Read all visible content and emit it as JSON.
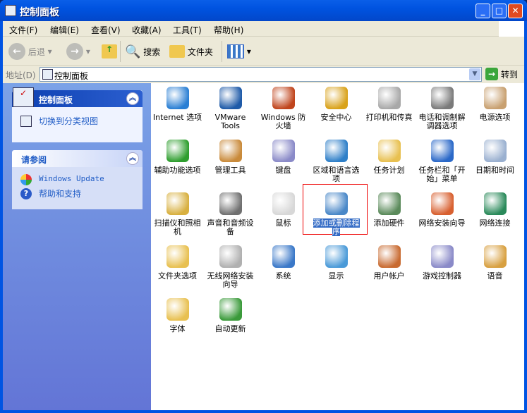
{
  "window": {
    "title": "控制面板"
  },
  "menu": [
    "文件(F)",
    "编辑(E)",
    "查看(V)",
    "收藏(A)",
    "工具(T)",
    "帮助(H)"
  ],
  "toolbar": {
    "back": "后退",
    "search": "搜索",
    "folders": "文件夹"
  },
  "address": {
    "label": "地址(D)",
    "value": "控制面板",
    "go": "转到"
  },
  "sidebar": {
    "panel1": {
      "title": "控制面板",
      "link": "切换到分类视图"
    },
    "panel2": {
      "title": "请参阅",
      "links": [
        "Windows Update",
        "帮助和支持"
      ]
    }
  },
  "items": [
    {
      "label": "Internet 选项",
      "color": "#2a7fd4"
    },
    {
      "label": "VMware Tools",
      "color": "#1e5aa8"
    },
    {
      "label": "Windows 防火墙",
      "color": "#c0451d"
    },
    {
      "label": "安全中心",
      "color": "#d9a21a"
    },
    {
      "label": "打印机和传真",
      "color": "#a8a8a8"
    },
    {
      "label": "电话和调制解调器选项",
      "color": "#7a7a7a"
    },
    {
      "label": "电源选项",
      "color": "#c8a070"
    },
    {
      "label": "辅助功能选项",
      "color": "#2e9e2e"
    },
    {
      "label": "管理工具",
      "color": "#c98a3a"
    },
    {
      "label": "键盘",
      "color": "#8a8ac8"
    },
    {
      "label": "区域和语言选项",
      "color": "#2e7fc8"
    },
    {
      "label": "任务计划",
      "color": "#e8c050"
    },
    {
      "label": "任务栏和「开始」菜单",
      "color": "#2a68c8"
    },
    {
      "label": "日期和时间",
      "color": "#9ab0d0"
    },
    {
      "label": "扫描仪和照相机",
      "color": "#d8b040"
    },
    {
      "label": "声音和音频设备",
      "color": "#707070"
    },
    {
      "label": "鼠标",
      "color": "#d8d8d8"
    },
    {
      "label": "添加或删除程序",
      "color": "#4a88c8",
      "selected": true
    },
    {
      "label": "添加硬件",
      "color": "#5a8a5a"
    },
    {
      "label": "网络安装向导",
      "color": "#d86030"
    },
    {
      "label": "网络连接",
      "color": "#2a8a5a"
    },
    {
      "label": "文件夹选项",
      "color": "#e8c050"
    },
    {
      "label": "无线网络安装向导",
      "color": "#b0b0b0"
    },
    {
      "label": "系统",
      "color": "#3a78c8"
    },
    {
      "label": "显示",
      "color": "#4a9ad8"
    },
    {
      "label": "用户帐户",
      "color": "#c86a30"
    },
    {
      "label": "游戏控制器",
      "color": "#8a8ac8"
    },
    {
      "label": "语音",
      "color": "#d8a040"
    },
    {
      "label": "字体",
      "color": "#e8c050"
    },
    {
      "label": "自动更新",
      "color": "#3a9a3a"
    }
  ]
}
